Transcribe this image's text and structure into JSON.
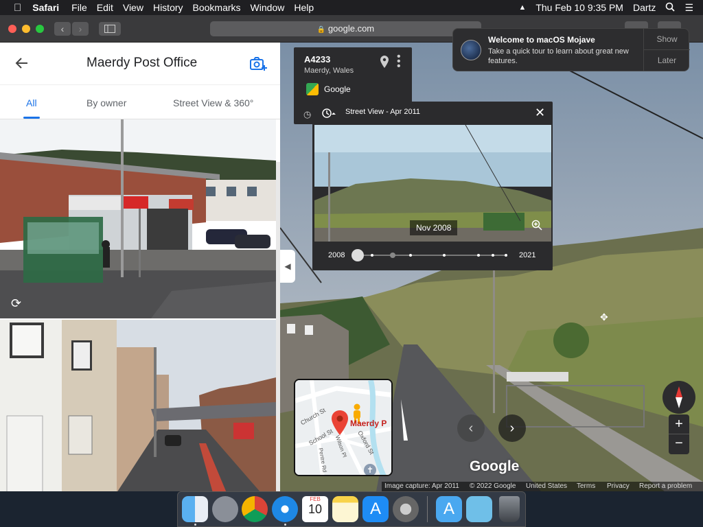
{
  "menubar": {
    "app": "Safari",
    "menus": [
      "File",
      "Edit",
      "View",
      "History",
      "Bookmarks",
      "Window",
      "Help"
    ],
    "clock": "Thu Feb 10  9:35 PM",
    "user": "Dartz"
  },
  "browser": {
    "url": "google.com"
  },
  "left_panel": {
    "title": "Maerdy Post Office",
    "tabs": [
      "All",
      "By owner",
      "Street View & 360°"
    ]
  },
  "info_card": {
    "title": "A4233",
    "subtitle": "Maerdy, Wales",
    "source": "Google"
  },
  "time_machine": {
    "header": "Street View - Apr 2011",
    "preview_date": "Nov 2008",
    "start_year": "2008",
    "end_year": "2021",
    "slider_position": 0
  },
  "notification": {
    "title": "Welcome to macOS Mojave",
    "body": "Take a quick tour to learn about great new features.",
    "show_label": "Show",
    "later_label": "Later"
  },
  "minimap": {
    "road_labels": [
      "Church St",
      "School St",
      "Wilson Pl",
      "Oxford St",
      "Pentre Rd"
    ],
    "place_label": "Maerdy P"
  },
  "footer": {
    "capture": "Image capture: Apr 2011",
    "copyright": "© 2022 Google",
    "country": "United States",
    "terms": "Terms",
    "privacy": "Privacy",
    "report": "Report a problem"
  },
  "google_logo": "Google",
  "dock": {
    "calendar_month": "FEB",
    "calendar_day": "10"
  },
  "colors": {
    "accent": "#1a73e8",
    "pin": "#ea4335",
    "panel_dark": "#2b2b2d"
  }
}
